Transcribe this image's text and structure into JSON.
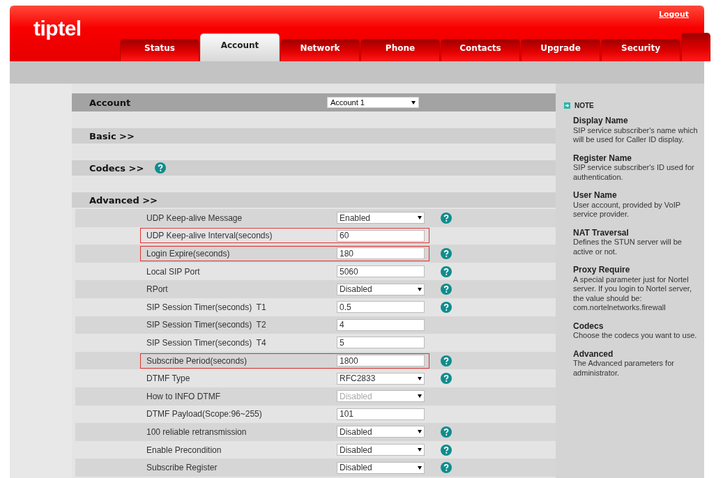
{
  "header": {
    "logo": "tiptel",
    "logout": "Logout"
  },
  "tabs": [
    {
      "label": "Status",
      "selected": false
    },
    {
      "label": "Account",
      "selected": true
    },
    {
      "label": "Network",
      "selected": false
    },
    {
      "label": "Phone",
      "selected": false
    },
    {
      "label": "Contacts",
      "selected": false
    },
    {
      "label": "Upgrade",
      "selected": false
    },
    {
      "label": "Security",
      "selected": false
    }
  ],
  "account": {
    "title": "Account",
    "select": "Account 1"
  },
  "sections": [
    {
      "title": "Basic >>",
      "help": false
    },
    {
      "title": "Codecs >>",
      "help": true
    },
    {
      "title": "Advanced >>",
      "help": false
    }
  ],
  "rows": [
    {
      "label": "UDP Keep-alive Message",
      "kind": "select",
      "value": "Enabled",
      "help": true,
      "disabled": false,
      "highlighted": false
    },
    {
      "label": "UDP Keep-alive Interval(seconds)",
      "kind": "input",
      "value": "60",
      "help": false,
      "highlighted": true
    },
    {
      "label": "Login Expire(seconds)",
      "kind": "input",
      "value": "180",
      "help": true,
      "highlighted": true
    },
    {
      "label": "Local SIP Port",
      "kind": "input",
      "value": "5060",
      "help": true,
      "highlighted": false
    },
    {
      "label": "RPort",
      "kind": "select",
      "value": "Disabled",
      "help": true,
      "disabled": false,
      "highlighted": false
    },
    {
      "label": "SIP Session Timer(seconds)  T1",
      "kind": "input",
      "value": "0.5",
      "help": true,
      "highlighted": false
    },
    {
      "label": "SIP Session Timer(seconds)  T2",
      "kind": "input",
      "value": "4",
      "help": false,
      "highlighted": false
    },
    {
      "label": "SIP Session Timer(seconds)  T4",
      "kind": "input",
      "value": "5",
      "help": false,
      "highlighted": false
    },
    {
      "label": "Subscribe Period(seconds)",
      "kind": "input",
      "value": "1800",
      "help": true,
      "highlighted": true
    },
    {
      "label": "DTMF Type",
      "kind": "select",
      "value": "RFC2833",
      "help": true,
      "disabled": false,
      "highlighted": false
    },
    {
      "label": "How to INFO DTMF",
      "kind": "select",
      "value": "Disabled",
      "help": false,
      "disabled": true,
      "highlighted": false
    },
    {
      "label": "DTMF Payload(Scope:96~255)",
      "kind": "input",
      "value": "101",
      "help": false,
      "highlighted": false
    },
    {
      "label": "100 reliable retransmission",
      "kind": "select",
      "value": "Disabled",
      "help": true,
      "disabled": false,
      "highlighted": false
    },
    {
      "label": "Enable Precondition",
      "kind": "select",
      "value": "Disabled",
      "help": true,
      "disabled": false,
      "highlighted": false
    },
    {
      "label": "Subscribe Register",
      "kind": "select",
      "value": "Disabled",
      "help": true,
      "disabled": false,
      "highlighted": false
    }
  ],
  "note": {
    "title": "NOTE",
    "items": [
      {
        "term": "Display Name",
        "text": "SIP service subscriber's name which will be used for Caller ID display."
      },
      {
        "term": "Register Name",
        "text": "SIP service subscriber's ID used for authentication."
      },
      {
        "term": "User Name",
        "text": "User account, provided by VoIP service provider."
      },
      {
        "term": "NAT Traversal",
        "text": "Defines the STUN server will be active or not."
      },
      {
        "term": "Proxy Require",
        "text": "A special parameter just for Nortel server. If you login to Nortel server, the value should be: com.nortelnetworks.firewall"
      },
      {
        "term": "Codecs",
        "text": "Choose the codecs you want to use."
      },
      {
        "term": "Advanced",
        "text": "The Advanced parameters for administrator."
      }
    ]
  }
}
